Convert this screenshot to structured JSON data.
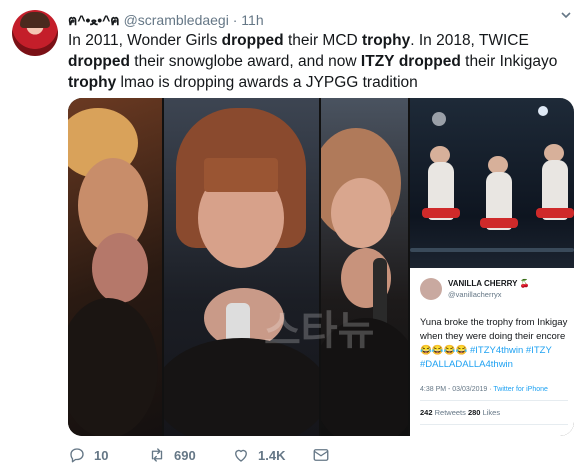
{
  "tweet": {
    "display_name": "ฅ^•ﻌ•^ฅ",
    "handle": "@scrambledaegi",
    "separator": "·",
    "time": "11h",
    "text_parts": [
      {
        "t": "In 2011, Wonder Girls ",
        "b": false
      },
      {
        "t": "dropped",
        "b": true
      },
      {
        "t": " their MCD ",
        "b": false
      },
      {
        "t": "trophy",
        "b": true
      },
      {
        "t": ". In 2018, TWICE ",
        "b": false
      },
      {
        "t": "dropped",
        "b": true
      },
      {
        "t": " their snowglobe award, and now ",
        "b": false
      },
      {
        "t": "ITZY",
        "b": true
      },
      {
        "t": " ",
        "b": false
      },
      {
        "t": "dropped",
        "b": true
      },
      {
        "t": " their Inkigayo ",
        "b": false
      },
      {
        "t": "trophy",
        "b": true
      },
      {
        "t": " lmao is dropping awards a JYPGG tradition",
        "b": false
      }
    ]
  },
  "media": {
    "watermark": "스타뉴",
    "embedded_tweet": {
      "name": "VANILLA CHERRY 🍒",
      "handle": "@vanillacherryx",
      "text": "Yuna broke the trophy from Inkigay when they were doing their encore",
      "emojis": "😂😂😂😂",
      "hashtags": "#ITZY4thwin #ITZY #DALLADALLA4thwin",
      "timestamp": "4:38 PM - 03/03/2019 · ",
      "source": "Twitter for iPhone",
      "retweets_count": "242",
      "retweets_label": "Retweets",
      "likes_count": "280",
      "likes_label": "Likes"
    }
  },
  "actions": {
    "replies": "10",
    "retweets": "690",
    "likes": "1.4K"
  },
  "icons": {
    "reply": "reply-icon",
    "retweet": "retweet-icon",
    "like": "heart-icon",
    "dm": "mail-icon",
    "more": "chevron-down-icon"
  },
  "colors": {
    "link": "#1da1f2",
    "muted": "#657786",
    "text": "#14171a"
  }
}
